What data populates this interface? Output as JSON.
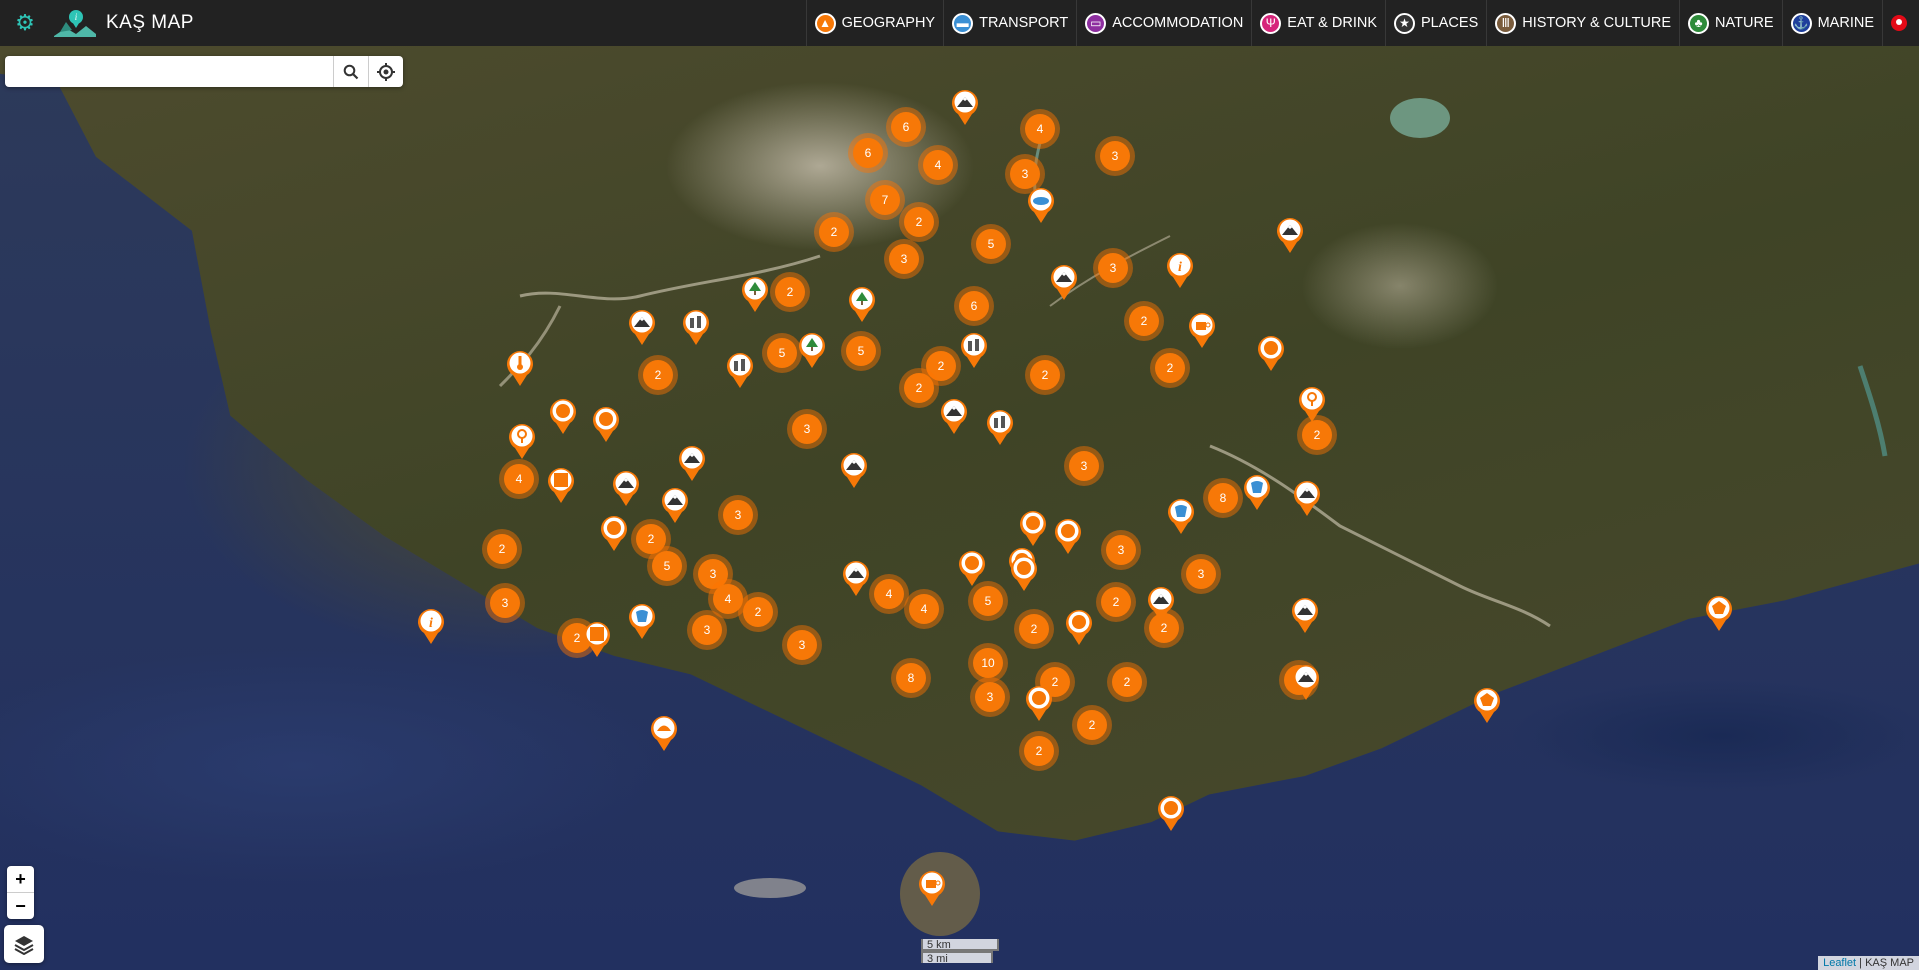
{
  "app": {
    "title": "KAŞ MAP",
    "settings_icon": "gear-icon",
    "logo_icon": "map-logo-icon"
  },
  "nav": [
    {
      "label": "GEOGRAPHY",
      "icon": "mountain-icon",
      "color": "#f77807"
    },
    {
      "label": "TRANSPORT",
      "icon": "bus-icon",
      "color": "#3a8fd4"
    },
    {
      "label": "ACCOMMODATION",
      "icon": "bed-icon",
      "color": "#8e2fa0"
    },
    {
      "label": "EAT & DRINK",
      "icon": "cutlery-icon",
      "color": "#d6257a"
    },
    {
      "label": "PLACES",
      "icon": "star-icon",
      "color": "#333333"
    },
    {
      "label": "HISTORY & CULTURE",
      "icon": "column-icon",
      "color": "#7a5c3c"
    },
    {
      "label": "NATURE",
      "icon": "leaf-icon",
      "color": "#2e8b3a"
    },
    {
      "label": "MARINE",
      "icon": "anchor-icon",
      "color": "#1e3f9c"
    }
  ],
  "language": {
    "flag": "turkey-flag-icon"
  },
  "search": {
    "value": "",
    "placeholder": ""
  },
  "zoom": {
    "in": "+",
    "out": "−"
  },
  "scale": {
    "km": "5 km",
    "mi": "3 mi"
  },
  "attribution": {
    "leaflet": "Leaflet",
    "sep": " | ",
    "site": "KAŞ MAP"
  },
  "clusters": [
    {
      "count": "6"
    },
    {
      "count": "4"
    },
    {
      "count": "3"
    },
    {
      "count": "6"
    },
    {
      "count": "4"
    },
    {
      "count": "3"
    },
    {
      "count": "7"
    },
    {
      "count": "2"
    },
    {
      "count": "2"
    },
    {
      "count": "3"
    },
    {
      "count": "5"
    },
    {
      "count": "3"
    },
    {
      "count": "2"
    },
    {
      "count": "6"
    },
    {
      "count": "2"
    },
    {
      "count": "5"
    },
    {
      "count": "5"
    },
    {
      "count": "2"
    },
    {
      "count": "2"
    },
    {
      "count": "2"
    },
    {
      "count": "2"
    },
    {
      "count": "2"
    },
    {
      "count": "3"
    },
    {
      "count": "2"
    },
    {
      "count": "3"
    },
    {
      "count": "4"
    },
    {
      "count": "3"
    },
    {
      "count": "8"
    },
    {
      "count": "2"
    },
    {
      "count": "2"
    },
    {
      "count": "3"
    },
    {
      "count": "3"
    },
    {
      "count": "3"
    },
    {
      "count": "3"
    },
    {
      "count": "2"
    },
    {
      "count": "4"
    },
    {
      "count": "5"
    },
    {
      "count": "2"
    },
    {
      "count": "2"
    },
    {
      "count": "2"
    },
    {
      "count": "4"
    },
    {
      "count": "5"
    },
    {
      "count": "4"
    },
    {
      "count": "3"
    },
    {
      "count": "3"
    },
    {
      "count": "2"
    },
    {
      "count": "10"
    },
    {
      "count": "8"
    },
    {
      "count": "2"
    },
    {
      "count": "2"
    },
    {
      "count": "3"
    },
    {
      "count": "2"
    },
    {
      "count": "2"
    },
    {
      "count": "2"
    }
  ],
  "pins": [
    {
      "icon": "mountain-icon"
    },
    {
      "icon": "lake-icon"
    },
    {
      "icon": "info-icon"
    },
    {
      "icon": "mountain-icon"
    },
    {
      "icon": "mountain-icon"
    },
    {
      "icon": "tree-icon"
    },
    {
      "icon": "tree-icon"
    },
    {
      "icon": "tree-icon"
    },
    {
      "icon": "mountain-icon"
    },
    {
      "icon": "ruins-icon"
    },
    {
      "icon": "ruins-icon"
    },
    {
      "icon": "ruins-icon"
    },
    {
      "icon": "thermometer-icon"
    },
    {
      "icon": "cafe-icon"
    },
    {
      "icon": "marker-icon"
    },
    {
      "icon": "marker-icon"
    },
    {
      "icon": "marker-icon"
    },
    {
      "icon": "ruins-icon"
    },
    {
      "icon": "mountain-icon"
    },
    {
      "icon": "mountain-icon"
    },
    {
      "icon": "viewpoint-icon"
    },
    {
      "icon": "viewpoint-icon"
    },
    {
      "icon": "square-icon"
    },
    {
      "icon": "mountain-icon"
    },
    {
      "icon": "mountain-icon"
    },
    {
      "icon": "mountain-icon"
    },
    {
      "icon": "marker-icon"
    },
    {
      "icon": "marker-icon"
    },
    {
      "icon": "waterfall-icon"
    },
    {
      "icon": "mountain-icon"
    },
    {
      "icon": "mountain-icon"
    },
    {
      "icon": "marker-icon"
    },
    {
      "icon": "marker-icon"
    },
    {
      "icon": "waterfall-icon"
    },
    {
      "icon": "marker-icon"
    },
    {
      "icon": "marker-icon"
    },
    {
      "icon": "mountain-icon"
    },
    {
      "icon": "marker-icon"
    },
    {
      "icon": "mountain-icon"
    },
    {
      "icon": "info-icon"
    },
    {
      "icon": "square-icon"
    },
    {
      "icon": "waterfall-icon"
    },
    {
      "icon": "beach-icon"
    },
    {
      "icon": "marker-icon"
    },
    {
      "icon": "marker-icon"
    },
    {
      "icon": "cafe-icon"
    },
    {
      "icon": "pentagon-icon"
    },
    {
      "icon": "pentagon-icon"
    },
    {
      "icon": "mountain-icon"
    }
  ]
}
